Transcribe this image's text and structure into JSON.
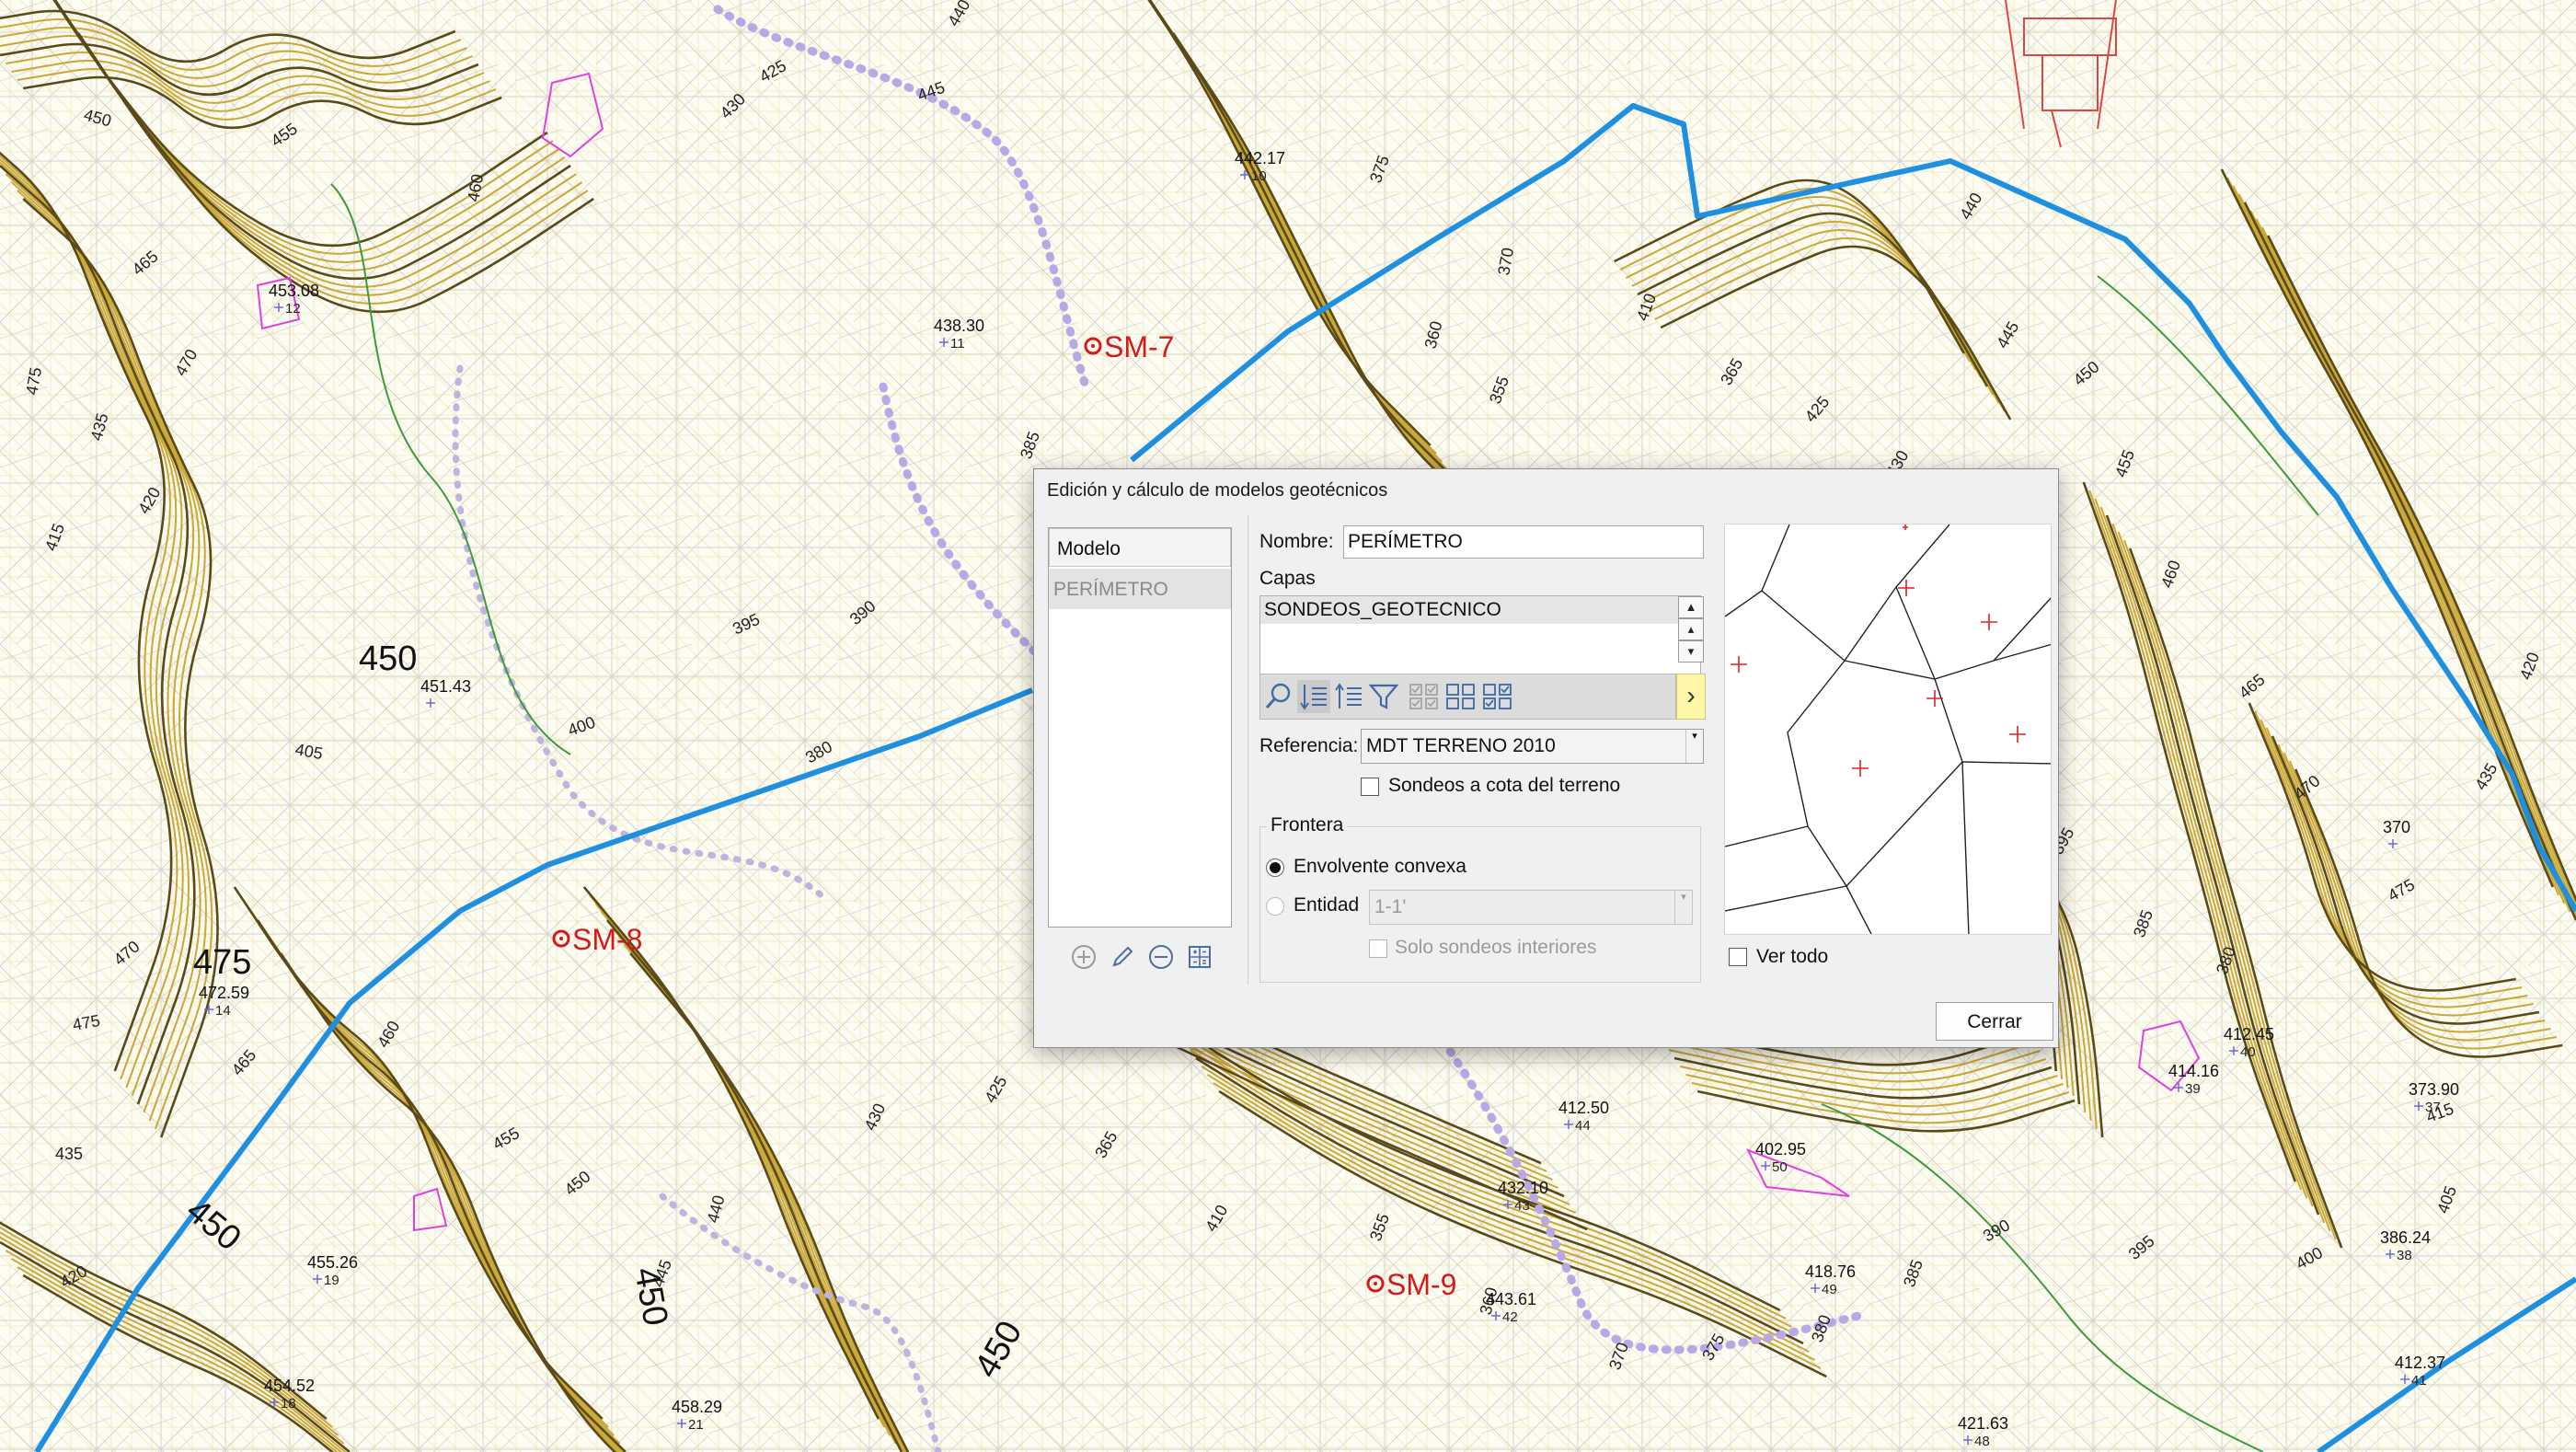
{
  "map": {
    "contour_labels": [
      "425",
      "430",
      "440",
      "445",
      "450",
      "455",
      "460",
      "465",
      "470",
      "475",
      "435",
      "420",
      "415",
      "405",
      "400",
      "395",
      "390",
      "385",
      "380",
      "375",
      "370",
      "360",
      "355",
      "410",
      "365"
    ],
    "major_labels": [
      "450",
      "475"
    ],
    "spot_heights": [
      {
        "elev": "442.17",
        "id": "10"
      },
      {
        "elev": "453.08",
        "id": "12"
      },
      {
        "elev": "438.30",
        "id": "11"
      },
      {
        "elev": "451.43",
        "id": ""
      },
      {
        "elev": "472.59",
        "id": "14"
      },
      {
        "elev": "455.26",
        "id": "19"
      },
      {
        "elev": "454.52",
        "id": "18"
      },
      {
        "elev": "458.29",
        "id": "21"
      },
      {
        "elev": "412.50",
        "id": "44"
      },
      {
        "elev": "402.95",
        "id": "50"
      },
      {
        "elev": "432.10",
        "id": "43"
      },
      {
        "elev": "443.61",
        "id": "42"
      },
      {
        "elev": "418.76",
        "id": "49"
      },
      {
        "elev": "421.63",
        "id": "48"
      },
      {
        "elev": "412.45",
        "id": "40"
      },
      {
        "elev": "414.16",
        "id": "39"
      },
      {
        "elev": "373.90",
        "id": "37"
      },
      {
        "elev": "386.24",
        "id": "38"
      },
      {
        "elev": "412.37",
        "id": "41"
      },
      {
        "elev": "370",
        "id": ""
      }
    ],
    "boreholes": [
      "SM-7",
      "SM-8",
      "SM-9"
    ],
    "colors": {
      "contour": "#caa837",
      "index_contour": "#5a4a1a",
      "tin": "#9a9a9a",
      "perimeter": "#1f8fe0",
      "borehole": "#d41a1a",
      "track": "#b9a7e6"
    }
  },
  "dialog": {
    "title": "Edición y cálculo de modelos geotécnicos",
    "list_header": "Modelo",
    "list_items": [
      "PERÍMETRO"
    ],
    "tools": [
      "add-icon",
      "edit-icon",
      "remove-icon",
      "calculator-icon"
    ],
    "nombre_label": "Nombre:",
    "nombre_value": "PERÍMETRO",
    "capas_label": "Capas",
    "capas_items": [
      "SONDEOS_GEOTECNICO"
    ],
    "referencia_label": "Referencia:",
    "referencia_value": "MDT TERRENO 2010",
    "sondeos_cota_label": "Sondeos a cota del terreno",
    "frontera_legend": "Frontera",
    "envolvente_label": "Envolvente convexa",
    "entidad_label": "Entidad",
    "entidad_value": "1-1'",
    "solo_sondeos_label": "Solo sondeos interiores",
    "ver_todo_label": "Ver todo",
    "cerrar_label": "Cerrar"
  }
}
